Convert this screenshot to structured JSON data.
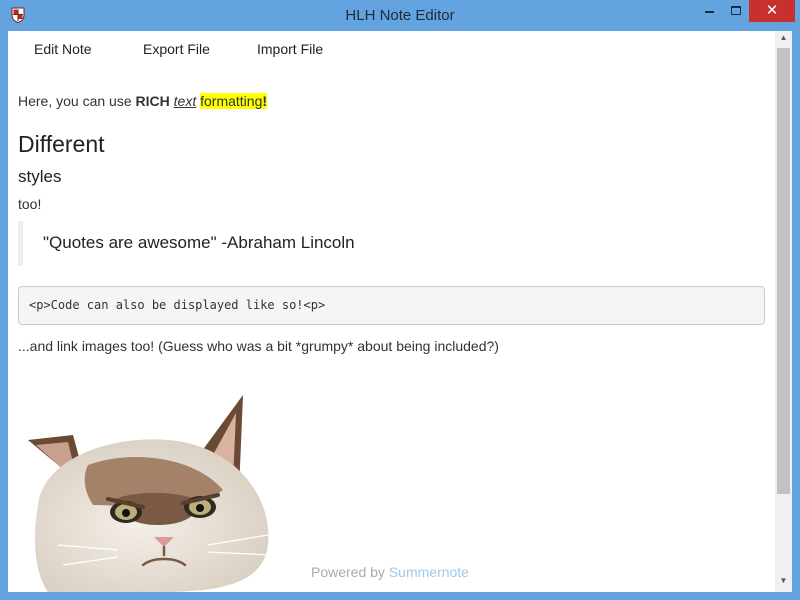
{
  "window": {
    "title": "HLH Note Editor",
    "icon": "app-shield-icon",
    "controls": {
      "minimize_icon": "minimize-icon",
      "maximize_icon": "maximize-icon",
      "close_glyph": "✕"
    }
  },
  "menu": {
    "edit_note": "Edit Note",
    "export_file": "Export File",
    "import_file": "Import File"
  },
  "content": {
    "intro_prefix": "Here, you can use ",
    "intro_bold": "RICH",
    "intro_space": " ",
    "intro_italic": "text",
    "intro_space2": " ",
    "intro_highlight": "formatting",
    "intro_bang": "!",
    "heading1": "Different",
    "heading2": "styles",
    "para_too": "too!",
    "quote": "\"Quotes are awesome\" -Abraham Lincoln",
    "code": "<p>Code can also be displayed like so!<p>",
    "link_text": "...and link images too! (Guess who was a bit *grumpy* about being included?)",
    "image_subject": "grumpy-cat-image"
  },
  "footer": {
    "powered_prefix": "Powered by ",
    "powered_link": "Summernote"
  },
  "scrollbar": {
    "up_glyph": "▲",
    "down_glyph": "▼"
  },
  "colors": {
    "titlebar": "#62a3e0",
    "close_button": "#c7302c",
    "highlight": "#ffff00",
    "footer_link": "#9ec8e8"
  }
}
